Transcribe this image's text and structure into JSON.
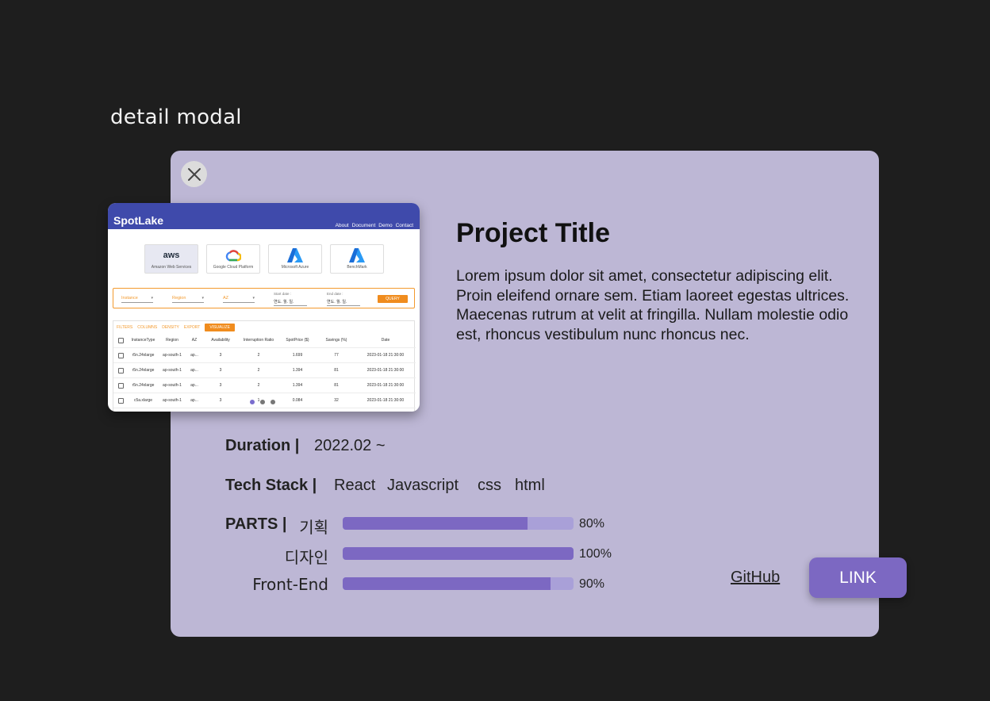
{
  "frame": {
    "label": "detail modal"
  },
  "screenshot": {
    "brand": "SpotLake",
    "nav_links": [
      "About",
      "Document",
      "Demo",
      "Contact"
    ],
    "providers": [
      {
        "logo": "aws",
        "name": "Amazon Web Services",
        "active": true
      },
      {
        "logo": "google-cloud-icon",
        "name": "Google Cloud Platform",
        "active": false
      },
      {
        "logo": "azure-icon",
        "name": "Microsoft Azure",
        "active": false
      },
      {
        "logo": "azure-icon",
        "name": "BenchMark",
        "active": false
      }
    ],
    "filters": {
      "instance": "Instance",
      "region": "Region",
      "az": "AZ",
      "start_label": "Start date :",
      "start_value": "연도. 월. 일.",
      "end_label": "End date :",
      "end_value": "연도. 월. 일.",
      "query": "QUERY"
    },
    "toolbar": [
      "FILTERS",
      "COLUMNS",
      "DENSITY",
      "EXPORT"
    ],
    "visualize": "VISUALIZE",
    "columns": [
      "InstanceType",
      "Region",
      "AZ",
      "Availability",
      "Interruption Ratio",
      "SpotPrice ($)",
      "Savings (%)",
      "Date"
    ],
    "rows": [
      [
        "r5n.24xlarge",
        "ap-south-1",
        "ap...",
        "3",
        "2",
        "1.699",
        "77",
        "2023-01-18 21:30:00"
      ],
      [
        "r5n.24xlarge",
        "ap-south-1",
        "ap...",
        "3",
        "2",
        "1.394",
        "81",
        "2023-01-18 21:30:00"
      ],
      [
        "r5n.24xlarge",
        "ap-south-1",
        "ap...",
        "3",
        "2",
        "1.394",
        "81",
        "2023-01-18 21:30:00"
      ],
      [
        "c5a.xlarge",
        "ap-south-1",
        "ap...",
        "3",
        "1",
        "0.084",
        "32",
        "2023-01-18 21:30:00"
      ]
    ],
    "carousel": {
      "count": 3,
      "active_index": 0
    }
  },
  "project": {
    "title": "Project Title",
    "description": "Lorem ipsum dolor sit amet, consectetur adipiscing elit. Proin eleifend ornare sem. Etiam laoreet egestas ultrices. Maecenas rutrum at velit at fringilla. Nullam molestie odio est, rhoncus vestibulum nunc rhoncus nec."
  },
  "details": {
    "duration_label": "Duration |",
    "duration_value": "2022.02 ~",
    "tech_label": "Tech Stack |",
    "tech_stack": [
      "React",
      "Javascript",
      "css",
      "html"
    ],
    "parts_label": "PARTS |",
    "parts": [
      {
        "name": "기획",
        "percent": 80,
        "percent_text": "80%"
      },
      {
        "name": "디자인",
        "percent": 100,
        "percent_text": "100%"
      },
      {
        "name": "Front-End",
        "percent": 90,
        "percent_text": "90%"
      }
    ]
  },
  "actions": {
    "github": "GitHub",
    "link": "LINK"
  },
  "colors": {
    "modal_bg": "#bdb7d5",
    "accent": "#7c68c2",
    "bar_track": "#a9a0d8",
    "page_bg": "#1e1e1e",
    "nav_blue": "#3f4aab",
    "orange": "#f08c1e"
  }
}
